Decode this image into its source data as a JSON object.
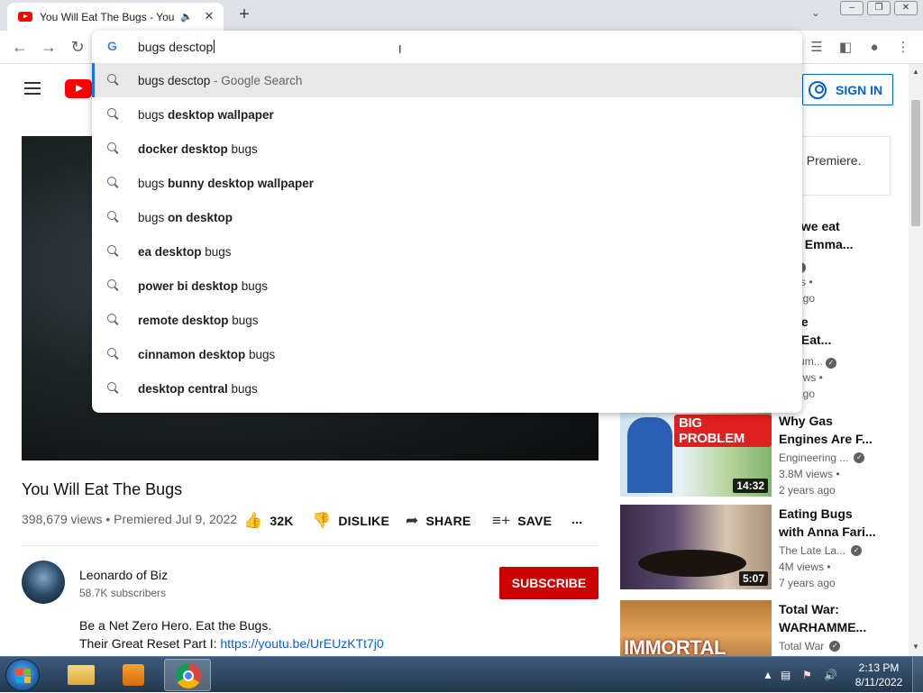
{
  "browser": {
    "tab": {
      "title": "You Will Eat The Bugs - YouTube",
      "audio_icon": "speaker-icon",
      "close": "✕"
    },
    "new_tab": "+",
    "window_buttons": [
      "–",
      "❐",
      "✕"
    ]
  },
  "omnibox": {
    "value": "bugs desctop",
    "suggestions": [
      {
        "pre": "bugs desctop",
        "bold": "",
        "post": "",
        "suffix": " - Google Search"
      },
      {
        "pre": "bugs ",
        "bold": "desktop wallpaper",
        "post": "",
        "suffix": ""
      },
      {
        "pre": "",
        "bold": "docker desktop",
        "post": " bugs",
        "suffix": ""
      },
      {
        "pre": "bugs ",
        "bold": "bunny desktop wallpaper",
        "post": "",
        "suffix": ""
      },
      {
        "pre": "bugs ",
        "bold": "on desktop",
        "post": "",
        "suffix": ""
      },
      {
        "pre": "",
        "bold": "ea desktop",
        "post": " bugs",
        "suffix": ""
      },
      {
        "pre": "",
        "bold": "power bi desktop",
        "post": " bugs",
        "suffix": ""
      },
      {
        "pre": "",
        "bold": "remote desktop",
        "post": " bugs",
        "suffix": ""
      },
      {
        "pre": "",
        "bold": "cinnamon desktop",
        "post": " bugs",
        "suffix": ""
      },
      {
        "pre": "",
        "bold": "desktop central",
        "post": " bugs",
        "suffix": ""
      }
    ]
  },
  "youtube": {
    "sign_in": "SIGN IN",
    "premiere_text": "his Premiere.",
    "video": {
      "title": "You Will Eat The Bugs",
      "meta": "398,679 views • Premiered Jul 9, 2022",
      "likes": "32K",
      "dislike": "DISLIKE",
      "share": "SHARE",
      "save": "SAVE",
      "more": "..."
    },
    "channel": {
      "name": "Leonardo of Biz",
      "subscribers": "58.7K subscribers",
      "subscribe": "SUBSCRIBE"
    },
    "description": {
      "line1": "Be a Net Zero Hero. Eat the Bugs.",
      "line2_prefix": "Their Great Reset Part I: ",
      "line2_link": "https://youtu.be/UrEUzKTt7j0"
    },
    "partial_recs": [
      {
        "t1": "uld we eat",
        "t2": "s? - Emma...",
        "ch": "Ed",
        "views": "views •",
        "ago": "ars ago"
      },
      {
        "t1": "yone",
        "t2": "uld Eat...",
        "ch": "geHum...",
        "views": "K views •",
        "ago": "ars ago"
      }
    ],
    "recommendations": [
      {
        "title": "Why Gas Engines Are F...",
        "channel": "Engineering ...",
        "views": "3.8M views •",
        "ago": "2 years ago",
        "duration": "14:32",
        "thumb_text": "BIG PROBLEM"
      },
      {
        "title": "Eating Bugs with Anna Fari...",
        "channel": "The Late La...",
        "views": "4M views •",
        "ago": "7 years ago",
        "duration": "5:07",
        "thumb_text": ""
      },
      {
        "title": "Total War: WARHAMME...",
        "channel": "Total War",
        "views": "",
        "ago": "",
        "duration": "",
        "thumb_text": "IMMORTAL"
      }
    ]
  },
  "taskbar": {
    "clock_time": "2:13 PM",
    "clock_date": "8/11/2022"
  }
}
